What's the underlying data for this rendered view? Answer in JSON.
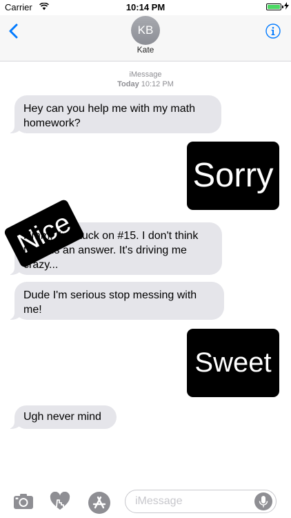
{
  "status_bar": {
    "carrier": "Carrier",
    "time": "10:14 PM",
    "battery_level": 1.0,
    "wifi_icon": "wifi-icon",
    "charging_icon": "bolt-icon"
  },
  "header": {
    "avatar_initials": "KB",
    "contact_name": "Kate",
    "back_icon": "chevron-left-icon",
    "info_icon": "info-icon"
  },
  "conversation": {
    "service": "iMessage",
    "day": "Today",
    "time": "10:12 PM",
    "messages": [
      {
        "type": "received",
        "text": "Hey can you help me with my math homework?"
      },
      {
        "type": "sticker",
        "text": "Sorry"
      },
      {
        "type": "received",
        "text": "Hmm, I'm stuck on #15. I don't think there is an answer. It's driving me crazy...",
        "visible_text": "m stuck on #15. I don't ere is an answer. It's driving e crazy..."
      },
      {
        "type": "sticker",
        "text": "Nice"
      },
      {
        "type": "received",
        "text": "Dude I'm serious stop messing with me!"
      },
      {
        "type": "sticker",
        "text": "Sweet"
      },
      {
        "type": "received",
        "text": "Ugh never mind"
      }
    ]
  },
  "input_bar": {
    "placeholder": "iMessage",
    "camera_icon": "camera-icon",
    "heart_icon": "digital-touch-heart-icon",
    "apps_icon": "app-store-icon",
    "mic_icon": "microphone-icon"
  },
  "colors": {
    "accent": "#007aff",
    "received_bubble": "#e5e5ea",
    "sticker_bg": "#000000",
    "battery": "#4cd964"
  }
}
